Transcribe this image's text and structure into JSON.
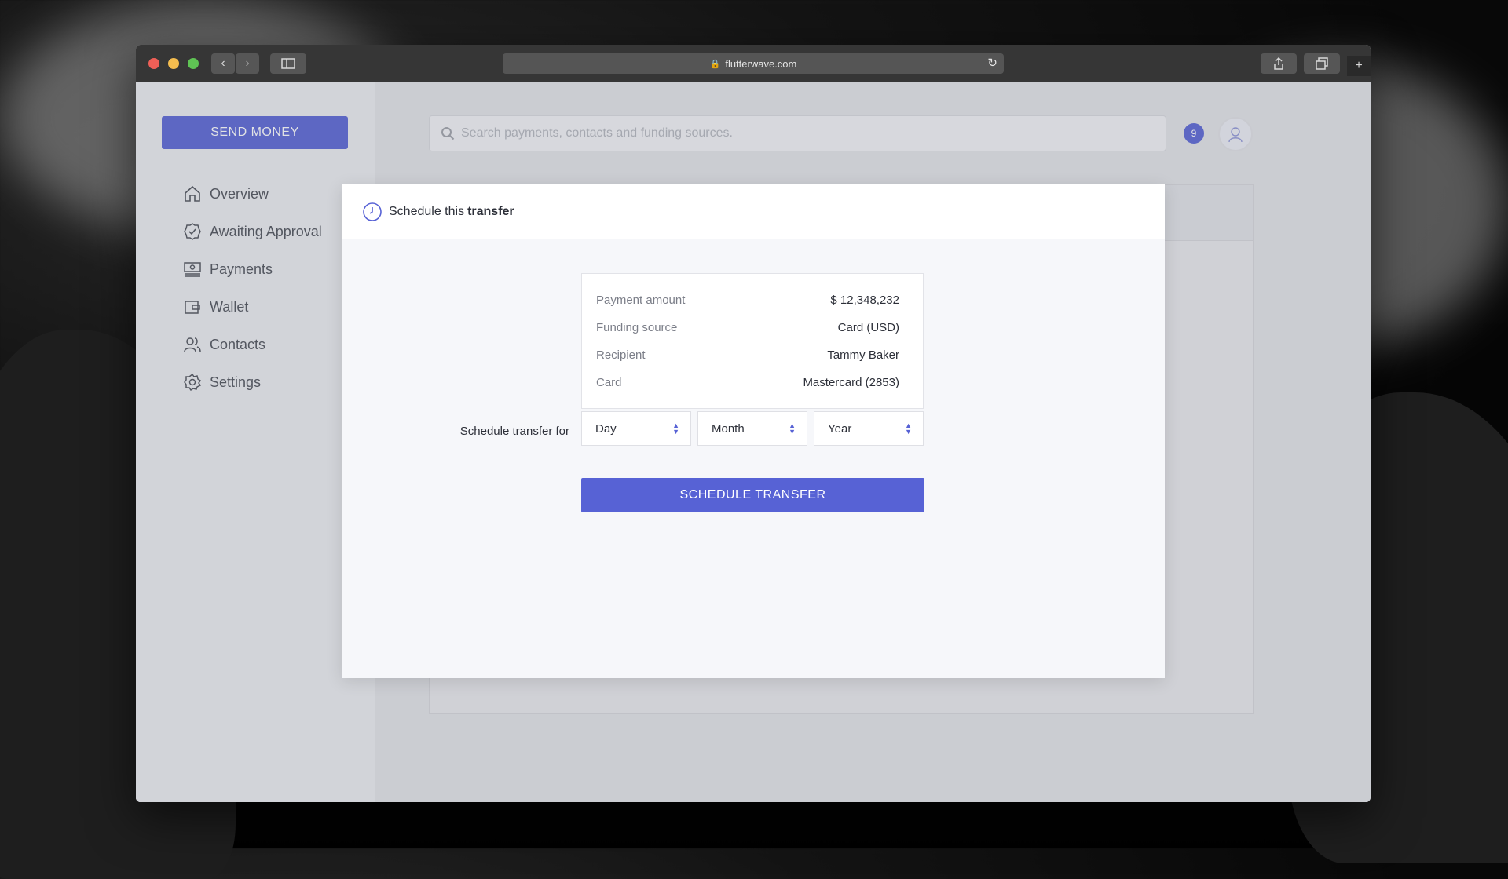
{
  "browser": {
    "url": "flutterwave.com"
  },
  "sidebar": {
    "send_money_label": "SEND MONEY",
    "items": [
      {
        "label": "Overview",
        "icon": "home-icon"
      },
      {
        "label": "Awaiting Approval",
        "icon": "badge-check-icon"
      },
      {
        "label": "Payments",
        "icon": "payments-icon"
      },
      {
        "label": "Wallet",
        "icon": "wallet-icon"
      },
      {
        "label": "Contacts",
        "icon": "contacts-icon"
      },
      {
        "label": "Settings",
        "icon": "gear-icon"
      }
    ]
  },
  "header": {
    "search_placeholder": "Search payments, contacts and funding sources.",
    "notification_count": "9"
  },
  "modal": {
    "title_prefix": "Schedule this",
    "title_strong": "transfer",
    "summary": [
      {
        "label": "Payment amount",
        "value": "$ 12,348,232"
      },
      {
        "label": "Funding source",
        "value": "Card (USD)"
      },
      {
        "label": "Recipient",
        "value": "Tammy Baker"
      },
      {
        "label": "Card",
        "value": "Mastercard (2853)"
      }
    ],
    "schedule_label": "Schedule transfer for",
    "selects": {
      "day": "Day",
      "month": "Month",
      "year": "Year"
    },
    "submit_label": "SCHEDULE TRANSFER"
  },
  "colors": {
    "accent": "#5762d5"
  }
}
